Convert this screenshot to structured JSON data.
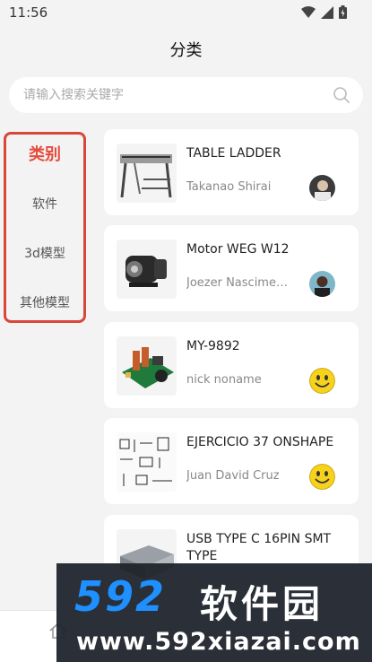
{
  "status_bar": {
    "time": "11:56"
  },
  "page": {
    "title": "分类"
  },
  "search": {
    "placeholder": "请输入搜索关键字"
  },
  "categories": {
    "header": "类别",
    "items": [
      {
        "label": "软件"
      },
      {
        "label": "3d模型"
      },
      {
        "label": "其他模型"
      }
    ]
  },
  "cards": [
    {
      "title": "TABLE LADDER",
      "author": "Takanao Shirai",
      "thumb_icon": "table-ladder-thumbnail",
      "avatar_icon": "user-photo-avatar"
    },
    {
      "title": "Motor WEG W12",
      "author": "Joezer Nascimento",
      "thumb_icon": "motor-thumbnail",
      "avatar_icon": "user-photo-avatar"
    },
    {
      "title": "MY-9892",
      "author": "nick noname",
      "thumb_icon": "circuit-board-thumbnail",
      "avatar_icon": "smiley-avatar"
    },
    {
      "title": "EJERCICIO 37 ONSHAPE",
      "author": "Juan David Cruz",
      "thumb_icon": "drawing-thumbnail",
      "avatar_icon": "smiley-avatar"
    },
    {
      "title": "USB TYPE C 16PIN SMT TYPE",
      "author": "",
      "thumb_icon": "usb-connector-thumbnail",
      "avatar_icon": ""
    }
  ],
  "watermark": {
    "brand": "592",
    "name": "软件园",
    "url": "www.592xiazai.com"
  },
  "colors": {
    "accent": "#e54c3c",
    "background": "#f3f3f3",
    "card": "#ffffff"
  }
}
